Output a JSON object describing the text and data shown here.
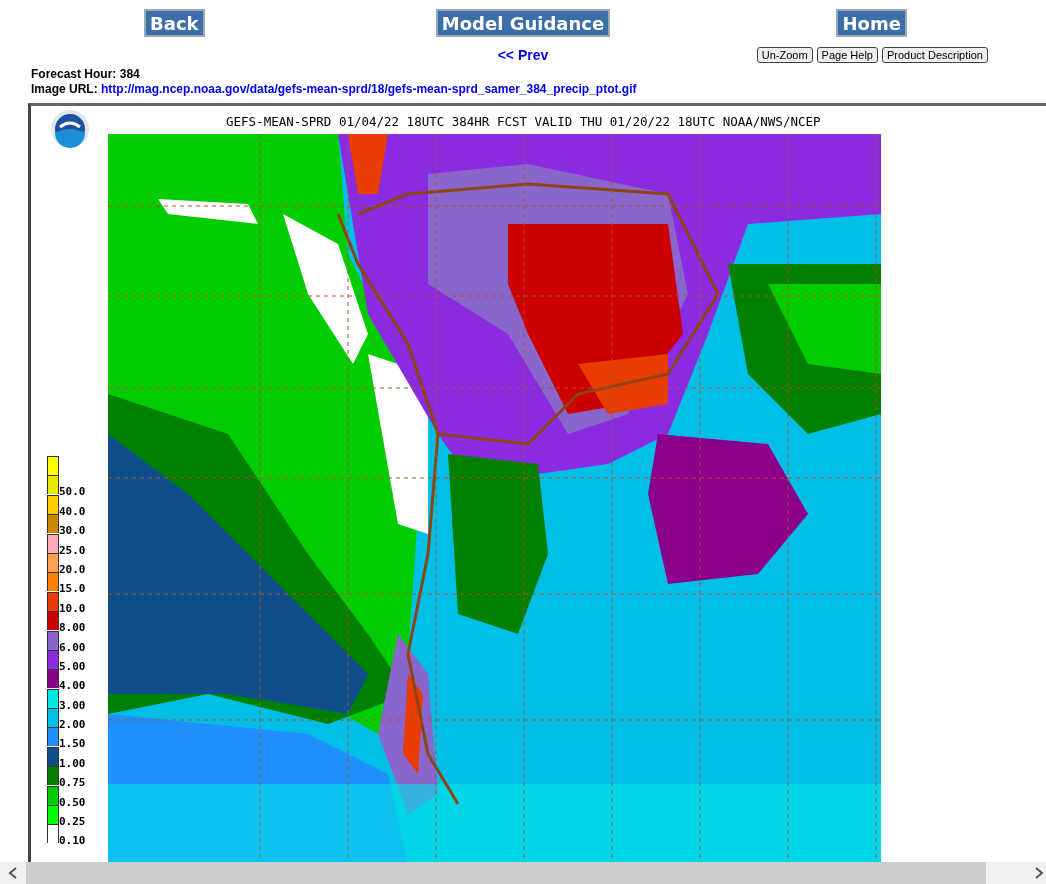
{
  "nav": {
    "back": "Back",
    "model_guidance": "Model Guidance",
    "home": "Home"
  },
  "prev_link": "<< Prev",
  "tool_buttons": [
    "Un-Zoom",
    "Page Help",
    "Product Description"
  ],
  "forecast_hour": {
    "label": "Forecast Hour:",
    "value": "384"
  },
  "image_url": {
    "label": "Image URL:",
    "link": "http://mag.ncep.noaa.gov/data/gefs-mean-sprd/18/gefs-mean-sprd_samer_384_precip_ptot.gif"
  },
  "map_image": {
    "title": "GEFS-MEAN-SPRD 01/04/22 18UTC 384HR FCST VALID THU 01/20/22 18UTC NOAA/NWS/NCEP",
    "legend": [
      {
        "color": "#ffff00"
      },
      {
        "label": "50.0",
        "color": "#e8e800"
      },
      {
        "label": "40.0",
        "color": "#ffcc00"
      },
      {
        "label": "30.0",
        "color": "#cc8800"
      },
      {
        "label": "25.0",
        "color": "#ffaabb"
      },
      {
        "label": "20.0",
        "color": "#ffa050"
      },
      {
        "label": "15.0",
        "color": "#ff7f00"
      },
      {
        "label": "10.0",
        "color": "#e83c00"
      },
      {
        "label": "8.00",
        "color": "#cc0000"
      },
      {
        "label": "6.00",
        "color": "#8866cc"
      },
      {
        "label": "5.00",
        "color": "#8a2be2"
      },
      {
        "label": "4.00",
        "color": "#8b008b"
      },
      {
        "label": "3.00",
        "color": "#00e6e6"
      },
      {
        "label": "2.00",
        "color": "#00bfe6"
      },
      {
        "label": "1.50",
        "color": "#1e90ff"
      },
      {
        "label": "1.00",
        "color": "#104e8b"
      },
      {
        "label": "0.75",
        "color": "#008000"
      },
      {
        "label": "0.50",
        "color": "#00cd00"
      },
      {
        "label": "0.25",
        "color": "#00ff00"
      },
      {
        "label": "0.10",
        "color": "#ffffff"
      }
    ]
  }
}
